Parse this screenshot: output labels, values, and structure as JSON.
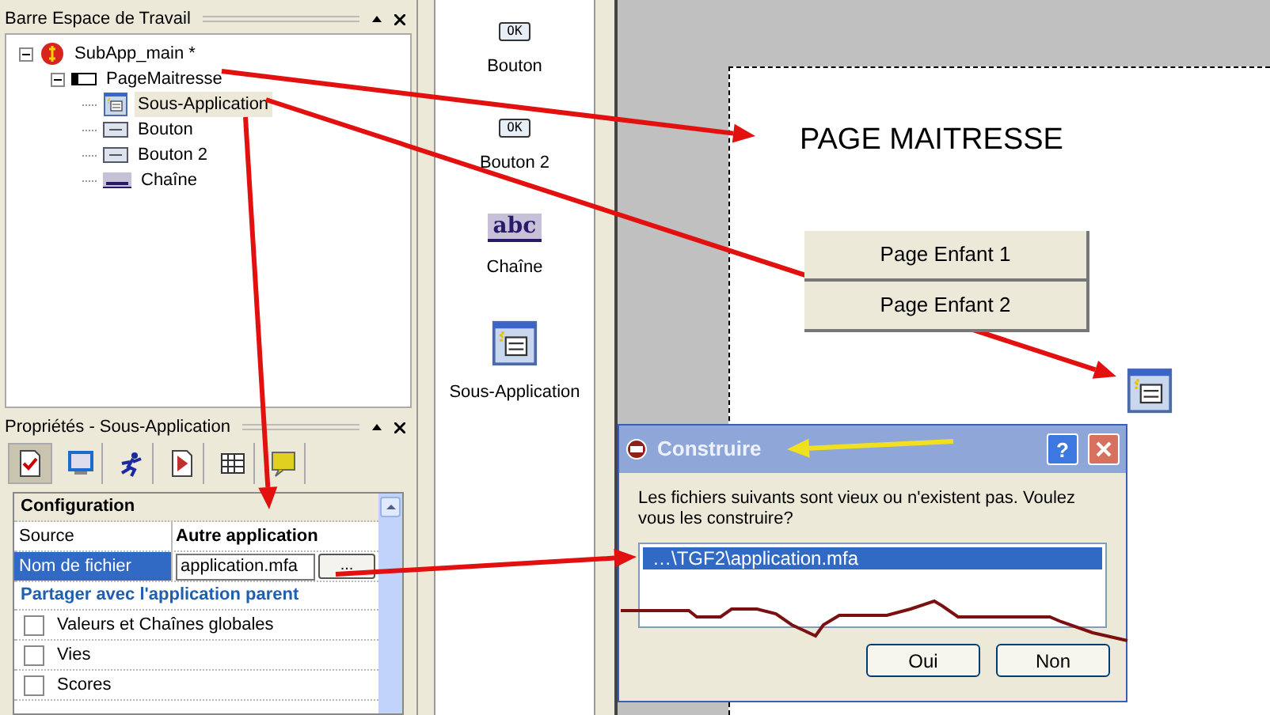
{
  "workspace_panel": {
    "title": "Barre Espace de Travail",
    "tree": [
      {
        "label": "SubApp_main *",
        "kind": "app",
        "expanded": true,
        "selected": false,
        "children": [
          {
            "label": "PageMaitresse",
            "kind": "frame",
            "expanded": true,
            "selected": false,
            "children": [
              {
                "label": "Sous-Application",
                "kind": "subapp",
                "selected": true
              },
              {
                "label": "Bouton",
                "kind": "button",
                "selected": false
              },
              {
                "label": "Bouton 2",
                "kind": "button",
                "selected": false
              },
              {
                "label": "Chaîne",
                "kind": "string",
                "selected": false
              }
            ]
          }
        ]
      }
    ]
  },
  "properties_panel": {
    "title": "Propriétés - Sous-Application",
    "tabs": [
      {
        "kind": "settings",
        "selected": true
      },
      {
        "kind": "display",
        "selected": false
      },
      {
        "kind": "runner",
        "selected": false
      },
      {
        "kind": "document",
        "selected": false
      },
      {
        "kind": "grid",
        "selected": false
      },
      {
        "kind": "note",
        "selected": false
      }
    ],
    "sections": [
      {
        "title": "Configuration",
        "kind": "header",
        "rows": [
          {
            "kind": "text",
            "label": "Source",
            "value": "Autre application",
            "selected": false
          },
          {
            "kind": "file",
            "label": "Nom de fichier",
            "value": "application.mfa",
            "button": "...",
            "selected": true
          }
        ]
      },
      {
        "title": "Partager avec l'application parent",
        "kind": "link",
        "rows": [
          {
            "kind": "checkbox",
            "label": "Valeurs et Chaînes globales",
            "checked": false
          },
          {
            "kind": "checkbox",
            "label": "Vies",
            "checked": false
          },
          {
            "kind": "checkbox",
            "label": "Scores",
            "checked": false
          }
        ]
      }
    ]
  },
  "toolbox": [
    {
      "kind": "button",
      "label": "Bouton",
      "icon_text": "OK"
    },
    {
      "kind": "button",
      "label": "Bouton 2",
      "icon_text": "OK"
    },
    {
      "kind": "string",
      "label": "Chaîne",
      "icon_text": "abc"
    },
    {
      "kind": "subapp",
      "label": "Sous-Application"
    }
  ],
  "canvas": {
    "title": "PAGE MAITRESSE",
    "buttons": [
      "Page Enfant 1",
      "Page Enfant 2"
    ]
  },
  "dialog": {
    "title": "Construire",
    "message": "Les fichiers suivants sont vieux ou n'existent pas. Voulez vous les construire?",
    "files": [
      {
        "label": "…\\TGF2\\application.mfa",
        "selected": true
      }
    ],
    "buttons": [
      "Oui",
      "Non"
    ],
    "help_label": "?"
  }
}
